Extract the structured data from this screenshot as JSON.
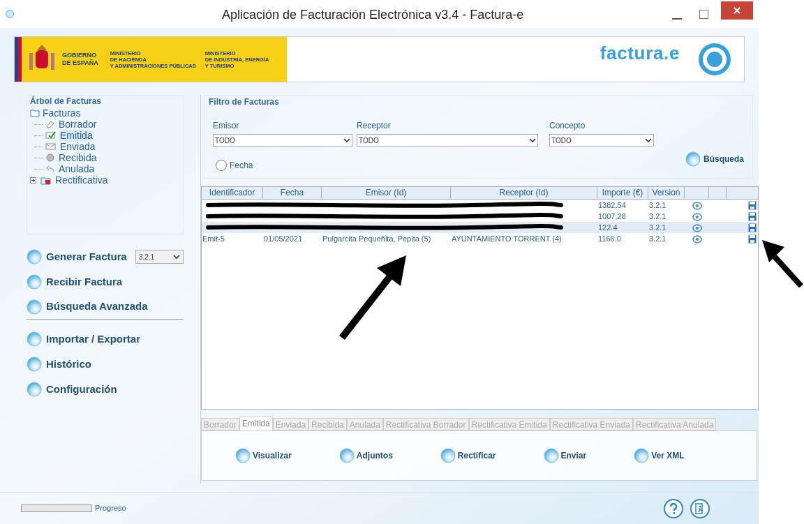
{
  "window": {
    "title": "Aplicación de Facturación Electrónica v3.4 - Factura-e"
  },
  "banner": {
    "gov_lines": [
      "GOBIERNO",
      "DE ESPAÑA"
    ],
    "ministry_1": [
      "MINISTERIO",
      "DE HACIENDA",
      "Y ADMINISTRACIONES PÚBLICAS"
    ],
    "ministry_2": [
      "MINISTERIO",
      "DE INDUSTRIA, ENERGÍA",
      "Y TURISMO"
    ],
    "logo_text": "factura.e"
  },
  "tree": {
    "title": "Árbol de Facturas",
    "root": {
      "label": "Facturas",
      "children": [
        {
          "label": "Borrador",
          "kind": "draft",
          "selected": false
        },
        {
          "label": "Emitida",
          "kind": "issued",
          "selected": true
        },
        {
          "label": "Enviada",
          "kind": "sent",
          "selected": false
        },
        {
          "label": "Recibida",
          "kind": "received",
          "selected": false
        },
        {
          "label": "Anulada",
          "kind": "cancelled",
          "selected": false
        },
        {
          "label": "Rectificativa",
          "kind": "corrective",
          "selected": false,
          "expanded": false
        }
      ]
    }
  },
  "actions": [
    {
      "label": "Generar Factura",
      "version_select": "3.2.1",
      "divider_after": false
    },
    {
      "label": "Recibir Factura",
      "divider_after": false
    },
    {
      "label": "Búsqueda Avanzada",
      "divider_after": true
    },
    {
      "label": "Importar / Exportar",
      "divider_after": false
    },
    {
      "label": "Histórico",
      "divider_after": false
    },
    {
      "label": "Configuración",
      "divider_after": false
    }
  ],
  "filter": {
    "title": "Filtro de Facturas",
    "fields": [
      {
        "label": "Emisor",
        "value": "TODO"
      },
      {
        "label": "Receptor",
        "value": "TODO"
      },
      {
        "label": "Concepto",
        "value": "TODO"
      }
    ],
    "date_option": {
      "label": "Fecha",
      "checked": false
    },
    "search_button": "Búsqueda"
  },
  "table": {
    "columns": [
      "Identificador",
      "Fecha",
      "Emisor (Id)",
      "Receptor (Id)",
      "Importe (€)",
      "Version"
    ],
    "rows": [
      {
        "cells": [
          null,
          null,
          null,
          null,
          "1382.54",
          "3.2.1"
        ],
        "selected": false,
        "redacted": true
      },
      {
        "cells": [
          null,
          null,
          null,
          null,
          "1007.28",
          "3.2.1"
        ],
        "selected": false,
        "redacted": true
      },
      {
        "cells": [
          null,
          null,
          null,
          null,
          "122.4",
          "3.2.1"
        ],
        "selected": true,
        "redacted": true
      },
      {
        "cells": [
          "Emit-5",
          "01/05/2021",
          "Pulgarcita Pequeñita, Pepita (5)",
          "AYUNTAMIENTO TORRENT (4)",
          "1166.0",
          "3.2.1"
        ],
        "selected": false,
        "redacted": false
      }
    ]
  },
  "tabs": [
    {
      "label": "Borrador",
      "selected": false
    },
    {
      "label": "Emitida",
      "selected": true
    },
    {
      "label": "Enviada",
      "selected": false
    },
    {
      "label": "Recibida",
      "selected": false
    },
    {
      "label": "Anulada",
      "selected": false
    },
    {
      "label": "Rectificativa Borrador",
      "selected": false
    },
    {
      "label": "Rectificativa Emitida",
      "selected": false
    },
    {
      "label": "Rectificativa Enviada",
      "selected": false
    },
    {
      "label": "Rectificativa Anulada",
      "selected": false
    }
  ],
  "tab_actions": [
    "Visualizar",
    "Adjuntos",
    "Rectificar",
    "Enviar",
    "Ver XML"
  ],
  "status_bar": {
    "progress_label": "Progreso",
    "level": 0
  }
}
